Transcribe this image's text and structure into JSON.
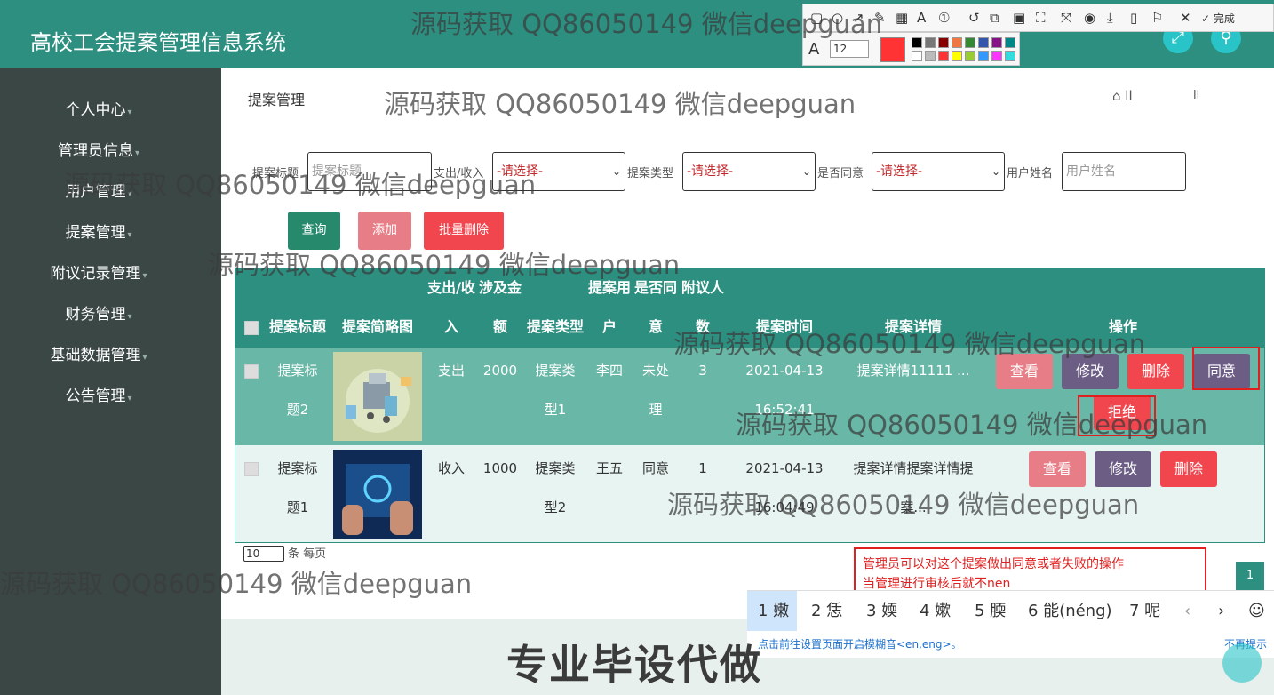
{
  "app": {
    "title": "高校工会提案管理信息系统"
  },
  "header_icons": [
    {
      "name": "fullscreen-icon",
      "glyph": "⤢"
    },
    {
      "name": "user-icon",
      "glyph": "⚲"
    }
  ],
  "sidebar": {
    "items": [
      {
        "label": "个人中心"
      },
      {
        "label": "管理员信息"
      },
      {
        "label": "用户管理"
      },
      {
        "label": "提案管理"
      },
      {
        "label": "附议记录管理"
      },
      {
        "label": "财务管理"
      },
      {
        "label": "基础数据管理"
      },
      {
        "label": "公告管理"
      }
    ],
    "caret": "▾"
  },
  "page": {
    "title": "提案管理",
    "home_glyph": "⌂ ll",
    "separator": "ll"
  },
  "filters": {
    "title_label": "提案标题",
    "title_placeholder": "提案标题",
    "income_label": "支出/收入",
    "income_value": "-请选择-",
    "type_label": "提案类型",
    "type_value": "-请选择-",
    "agree_label": "是否同意",
    "agree_value": "-请选择-",
    "user_label": "用户姓名",
    "user_placeholder": "用户姓名"
  },
  "buttons": {
    "query": "查询",
    "add": "添加",
    "batch_delete": "批量删除"
  },
  "table": {
    "headers": {
      "title": "提案标题",
      "image": "提案简略图",
      "io": [
        "支出/收",
        "入"
      ],
      "amount": [
        "涉及金",
        "额"
      ],
      "type": "提案类型",
      "user": [
        "提案用",
        "户"
      ],
      "agree": [
        "是否同",
        "意"
      ],
      "seconds": [
        "附议人",
        "数"
      ],
      "time": "提案时间",
      "detail": "提案详情",
      "ops": "操作"
    },
    "rows": [
      {
        "title": [
          "提案标",
          "题2"
        ],
        "io": "支出",
        "amount": "2000",
        "type": [
          "提案类",
          "型1"
        ],
        "user": "李四",
        "agree": [
          "未处",
          "理"
        ],
        "seconds": "3",
        "time": [
          "2021-04-13",
          "16:52:41"
        ],
        "detail": [
          "提案详情11111 ..."
        ],
        "actions": {
          "view": "查看",
          "edit": "修改",
          "delete": "删除",
          "agree": "同意",
          "reject": "拒绝"
        }
      },
      {
        "title": [
          "提案标",
          "题1"
        ],
        "io": "收入",
        "amount": "1000",
        "type": [
          "提案类",
          "型2"
        ],
        "user": "王五",
        "agree": [
          "同意",
          ""
        ],
        "seconds": "1",
        "time": [
          "2021-04-13",
          "16:04:49"
        ],
        "detail": [
          "提案详情提案详情提",
          "案..."
        ],
        "actions": {
          "view": "查看",
          "edit": "修改",
          "delete": "删除"
        }
      }
    ]
  },
  "pagination": {
    "page_size": "10",
    "per_page_label": "条 每页",
    "current": "1"
  },
  "annotation": {
    "line1": "管理员可以对这个提案做出同意或者失败的操作",
    "line2": "当管理进行审核后就不nen"
  },
  "ime": {
    "candidates": [
      "1 嫩",
      "2 恁",
      "3 媆",
      "4 嫰",
      "5 腝",
      "6 能(néng)",
      "7 呢"
    ],
    "prev": "‹",
    "next": "›",
    "emoji": "☺",
    "tip": "点击前往设置页面开启模糊音<en,eng>。",
    "dismiss": "不再提示"
  },
  "toolbar": {
    "done": "✓ 完成",
    "font_size": "12"
  },
  "watermark": "源码获取 QQ86050149 微信deepguan",
  "promo": "专业毕设代做",
  "colors": {
    "brand": "#2d8f80",
    "sidebar": "#3a4745",
    "red": "#e02020",
    "teal_icon": "#29c4c8"
  }
}
